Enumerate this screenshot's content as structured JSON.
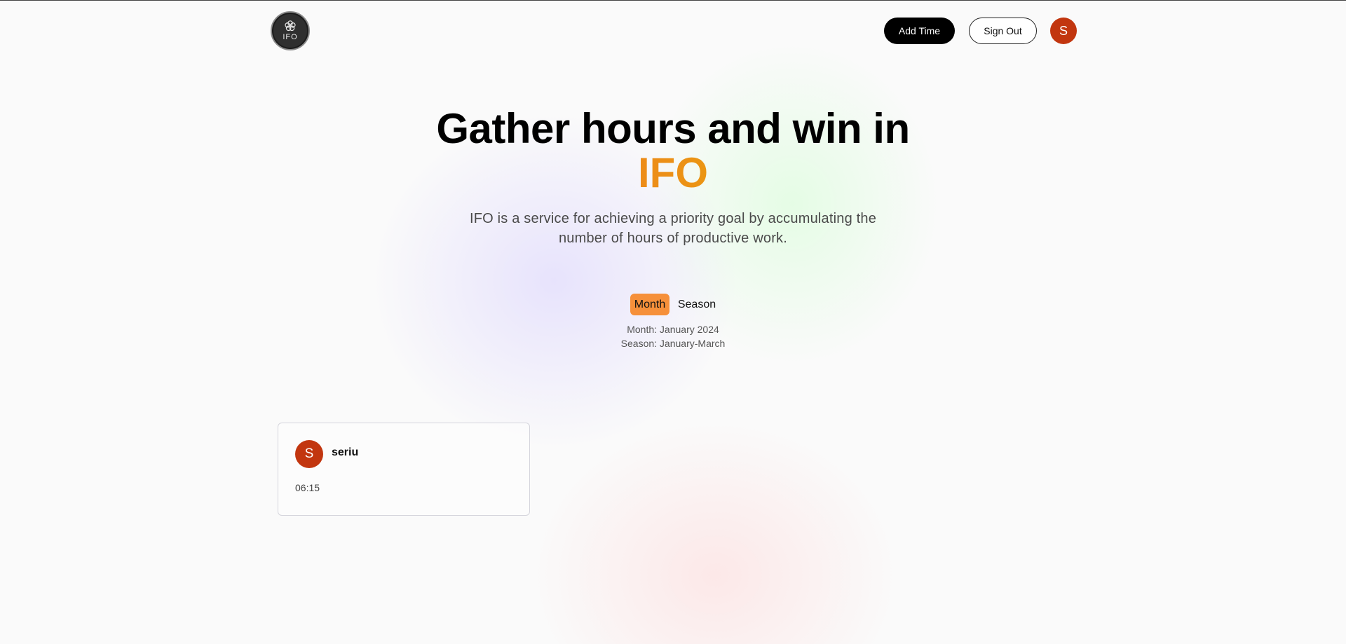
{
  "header": {
    "logo_text": "IFO",
    "add_time_label": "Add Time",
    "sign_out_label": "Sign Out",
    "avatar_initial": "S"
  },
  "hero": {
    "title": "Gather hours and win in",
    "brand": "IFO",
    "subtitle": "IFO is a service for achieving a priority goal by accumulating the number of hours of productive work."
  },
  "period": {
    "tabs": [
      {
        "label": "Month",
        "active": true
      },
      {
        "label": "Season",
        "active": false
      }
    ],
    "month_info": "Month: January 2024",
    "season_info": "Season: January-March"
  },
  "leaderboard": [
    {
      "initial": "S",
      "name": "seriu",
      "time": "06:15"
    }
  ],
  "colors": {
    "accent": "#f6903a",
    "brand_gradient_start": "#f07d22",
    "brand_gradient_end": "#e8a40a",
    "avatar": "#c2360f",
    "primary_button": "#000000"
  }
}
